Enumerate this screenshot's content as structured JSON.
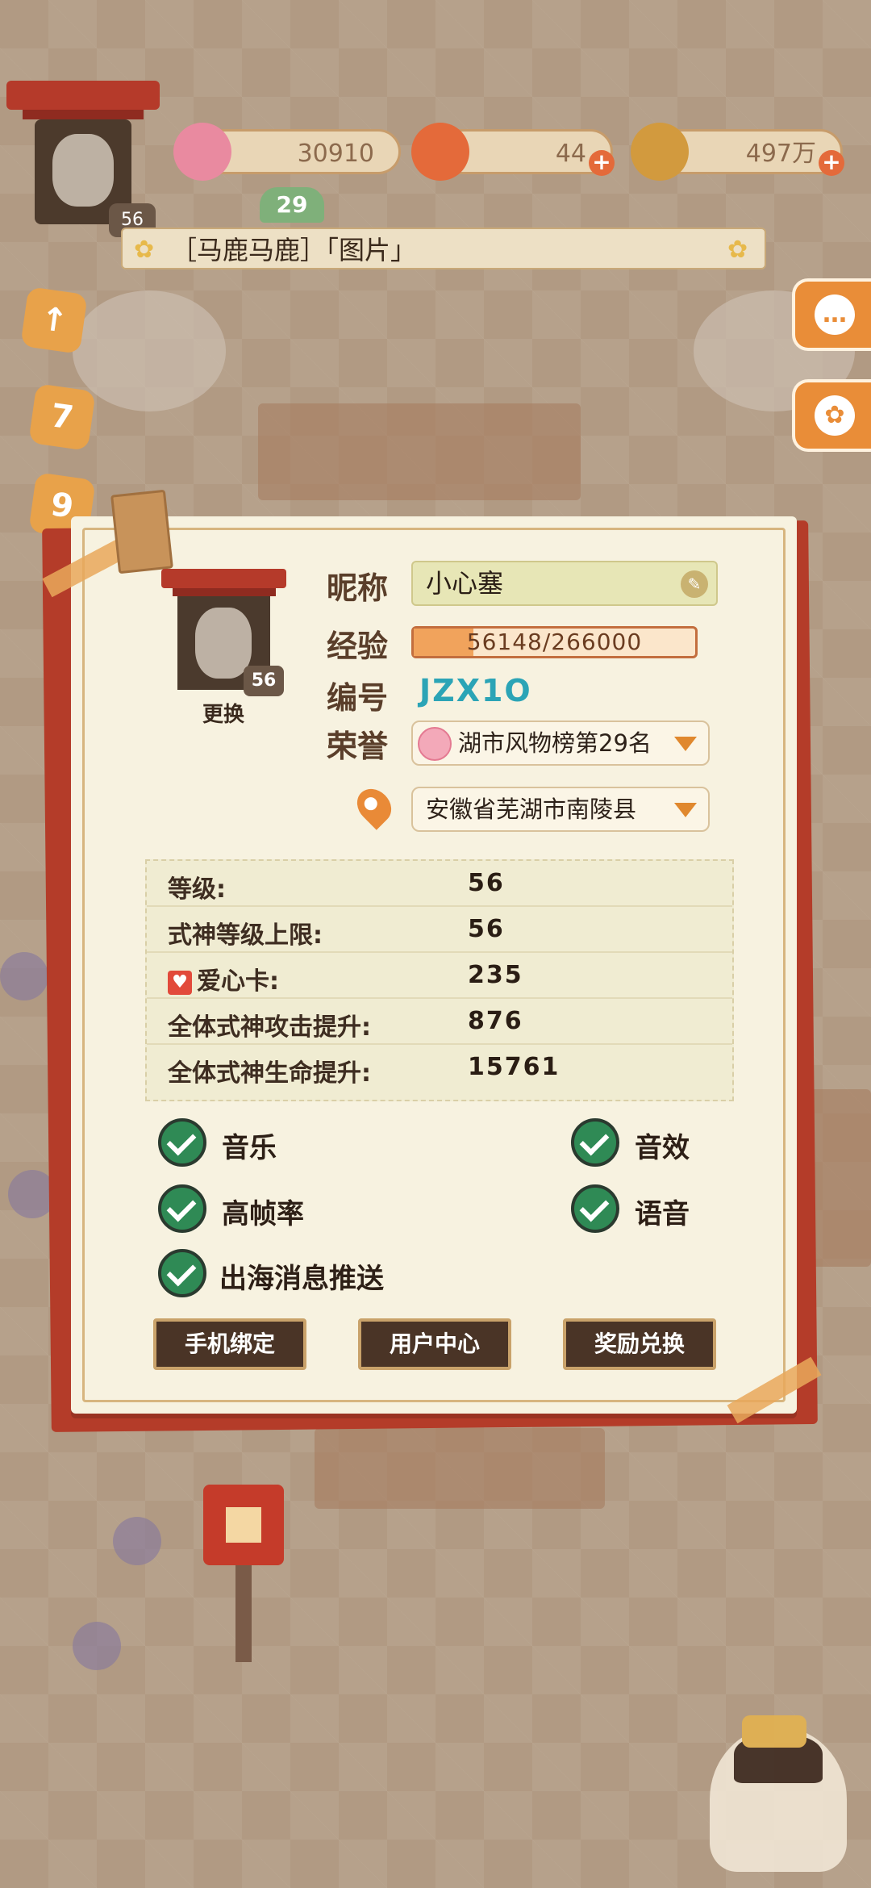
{
  "top_bar": {
    "player_level": "56",
    "resources": [
      {
        "icon": "sakura-icon",
        "value": "30910",
        "color": "#e98aa0"
      },
      {
        "icon": "ticket-icon",
        "value": "44",
        "color": "#e46a3a"
      },
      {
        "icon": "coin-icon",
        "value": "497万",
        "color": "#d29a3e"
      }
    ],
    "sub_level": "29",
    "title_banner": "［马鹿马鹿］「图片」"
  },
  "side_buttons": [
    {
      "icon": "chat-icon"
    },
    {
      "icon": "bento-icon"
    }
  ],
  "left_buttons": [
    {
      "icon": "arrow-up-icon"
    },
    {
      "icon": "seven-icon"
    },
    {
      "icon": "ticket-icon"
    }
  ],
  "profile": {
    "avatar_level": "56",
    "change_label": "更换",
    "nickname_label": "昵称",
    "nickname": "小心塞",
    "exp_label": "经验",
    "exp_value": "56148/266000",
    "exp_progress": 0.211,
    "id_label": "编号",
    "id_value": "JZX1O",
    "honor_label": "荣誉",
    "honor_value": "湖市风物榜第29名",
    "location_value": "安徽省芜湖市南陵县"
  },
  "stats": [
    {
      "key": "等级:",
      "value": "56"
    },
    {
      "key": "式神等级上限:",
      "value": "56"
    },
    {
      "key": "爱心卡:",
      "value": "235",
      "icon": "heart-card-icon"
    },
    {
      "key": "全体式神攻击提升:",
      "value": "876"
    },
    {
      "key": "全体式神生命提升:",
      "value": "15761"
    }
  ],
  "settings": {
    "music": "音乐",
    "sfx": "音效",
    "high_fps": "高帧率",
    "voice": "语音",
    "push": "出海消息推送"
  },
  "buttons": {
    "bind_phone": "手机绑定",
    "user_center": "用户中心",
    "redeem": "奖励兑换"
  }
}
